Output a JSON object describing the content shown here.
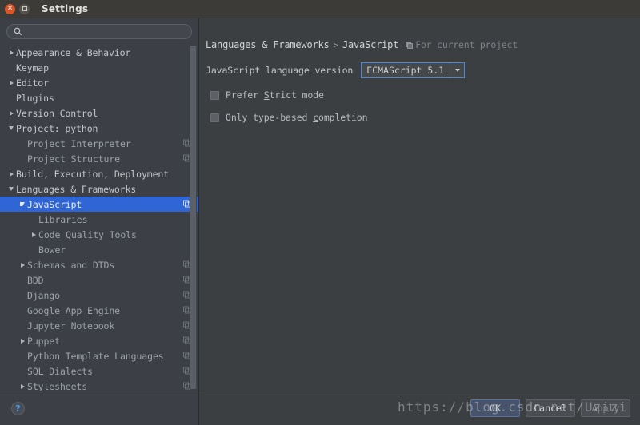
{
  "window": {
    "title": "Settings",
    "close_icon": "close-icon",
    "maximize_icon": "maximize-icon"
  },
  "sidebar": {
    "search": {
      "value": "",
      "placeholder": "",
      "icon": "search-icon"
    },
    "items": [
      {
        "label": "Appearance & Behavior",
        "indent": 0,
        "arrow": "right",
        "badge": false,
        "selected": false,
        "dim": false
      },
      {
        "label": "Keymap",
        "indent": 0,
        "arrow": "none",
        "badge": false,
        "selected": false,
        "dim": false
      },
      {
        "label": "Editor",
        "indent": 0,
        "arrow": "right",
        "badge": false,
        "selected": false,
        "dim": false
      },
      {
        "label": "Plugins",
        "indent": 0,
        "arrow": "none",
        "badge": false,
        "selected": false,
        "dim": false
      },
      {
        "label": "Version Control",
        "indent": 0,
        "arrow": "right",
        "badge": false,
        "selected": false,
        "dim": false
      },
      {
        "label": "Project: python",
        "indent": 0,
        "arrow": "down",
        "badge": false,
        "selected": false,
        "dim": false
      },
      {
        "label": "Project Interpreter",
        "indent": 1,
        "arrow": "none",
        "badge": true,
        "selected": false,
        "dim": true
      },
      {
        "label": "Project Structure",
        "indent": 1,
        "arrow": "none",
        "badge": true,
        "selected": false,
        "dim": true
      },
      {
        "label": "Build, Execution, Deployment",
        "indent": 0,
        "arrow": "right",
        "badge": false,
        "selected": false,
        "dim": false
      },
      {
        "label": "Languages & Frameworks",
        "indent": 0,
        "arrow": "down",
        "badge": false,
        "selected": false,
        "dim": false
      },
      {
        "label": "JavaScript",
        "indent": 1,
        "arrow": "down",
        "badge": true,
        "selected": true,
        "dim": false
      },
      {
        "label": "Libraries",
        "indent": 2,
        "arrow": "none",
        "badge": false,
        "selected": false,
        "dim": true
      },
      {
        "label": "Code Quality Tools",
        "indent": 2,
        "arrow": "right",
        "badge": false,
        "selected": false,
        "dim": true
      },
      {
        "label": "Bower",
        "indent": 2,
        "arrow": "none",
        "badge": false,
        "selected": false,
        "dim": true
      },
      {
        "label": "Schemas and DTDs",
        "indent": 1,
        "arrow": "right",
        "badge": true,
        "selected": false,
        "dim": true
      },
      {
        "label": "BDD",
        "indent": 1,
        "arrow": "none",
        "badge": true,
        "selected": false,
        "dim": true
      },
      {
        "label": "Django",
        "indent": 1,
        "arrow": "none",
        "badge": true,
        "selected": false,
        "dim": true
      },
      {
        "label": "Google App Engine",
        "indent": 1,
        "arrow": "none",
        "badge": true,
        "selected": false,
        "dim": true
      },
      {
        "label": "Jupyter Notebook",
        "indent": 1,
        "arrow": "none",
        "badge": true,
        "selected": false,
        "dim": true
      },
      {
        "label": "Puppet",
        "indent": 1,
        "arrow": "right",
        "badge": true,
        "selected": false,
        "dim": true
      },
      {
        "label": "Python Template Languages",
        "indent": 1,
        "arrow": "none",
        "badge": true,
        "selected": false,
        "dim": true
      },
      {
        "label": "SQL Dialects",
        "indent": 1,
        "arrow": "none",
        "badge": true,
        "selected": false,
        "dim": true
      },
      {
        "label": "Stylesheets",
        "indent": 1,
        "arrow": "right",
        "badge": true,
        "selected": false,
        "dim": true
      }
    ],
    "help_label": "?"
  },
  "main": {
    "breadcrumb": {
      "root": "Languages & Frameworks",
      "separator": ">",
      "current": "JavaScript",
      "scope_note": "For current project",
      "scope_icon": "project-scope-icon"
    },
    "language_version": {
      "label": "JavaScript language version",
      "value": "ECMAScript 5.1",
      "arrow_icon": "chevron-down-icon"
    },
    "checkboxes": [
      {
        "prefix": "Prefer ",
        "mnemonic": "S",
        "suffix": "trict mode",
        "checked": false
      },
      {
        "prefix": "Only type-based ",
        "mnemonic": "c",
        "suffix": "ompletion",
        "checked": false
      }
    ]
  },
  "footer": {
    "buttons": [
      {
        "label": "OK",
        "style": "default",
        "enabled": true
      },
      {
        "label": "Cancel",
        "style": "normal",
        "enabled": true
      },
      {
        "label": "Apply",
        "style": "normal",
        "enabled": false
      }
    ]
  },
  "watermark": {
    "text": "https://blog.csdn.net/Uzizi"
  },
  "colors": {
    "selection": "#2f65d4",
    "sidebar_bg": "#3c4046",
    "panel_bg": "#3c3f41",
    "focus_border": "#4a88d8",
    "help_glyph": "#4a9de8",
    "close_button": "#d8562a"
  }
}
